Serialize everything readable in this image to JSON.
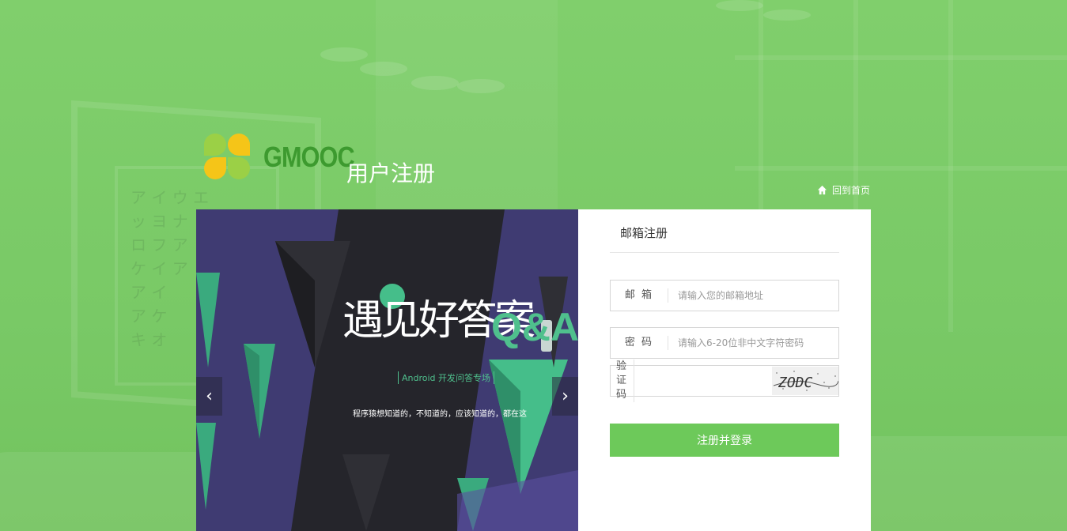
{
  "header": {
    "brand": "GMOOC",
    "page_title": "用户注册",
    "home_link": "回到首页"
  },
  "banner": {
    "headline": "遇见好答案",
    "tagline": "Android 开发问答专场",
    "subline": "程序猿想知道的，不知道的，应该知道的，都在这",
    "qa": "Q&A",
    "prev_label": "‹",
    "next_label": "›"
  },
  "register": {
    "tab_label": "邮箱注册",
    "email": {
      "label": "邮 箱",
      "placeholder": "请输入您的邮箱地址",
      "value": ""
    },
    "password": {
      "label": "密 码",
      "placeholder": "请输入6-20位非中文字符密码",
      "value": ""
    },
    "captcha": {
      "label": "验证码",
      "value": "",
      "image_text": "ZODC"
    },
    "submit_label": "注册并登录"
  },
  "colors": {
    "background": "#7ccd69",
    "accent": "#6dc95a",
    "brand": "#3d9a2f"
  }
}
